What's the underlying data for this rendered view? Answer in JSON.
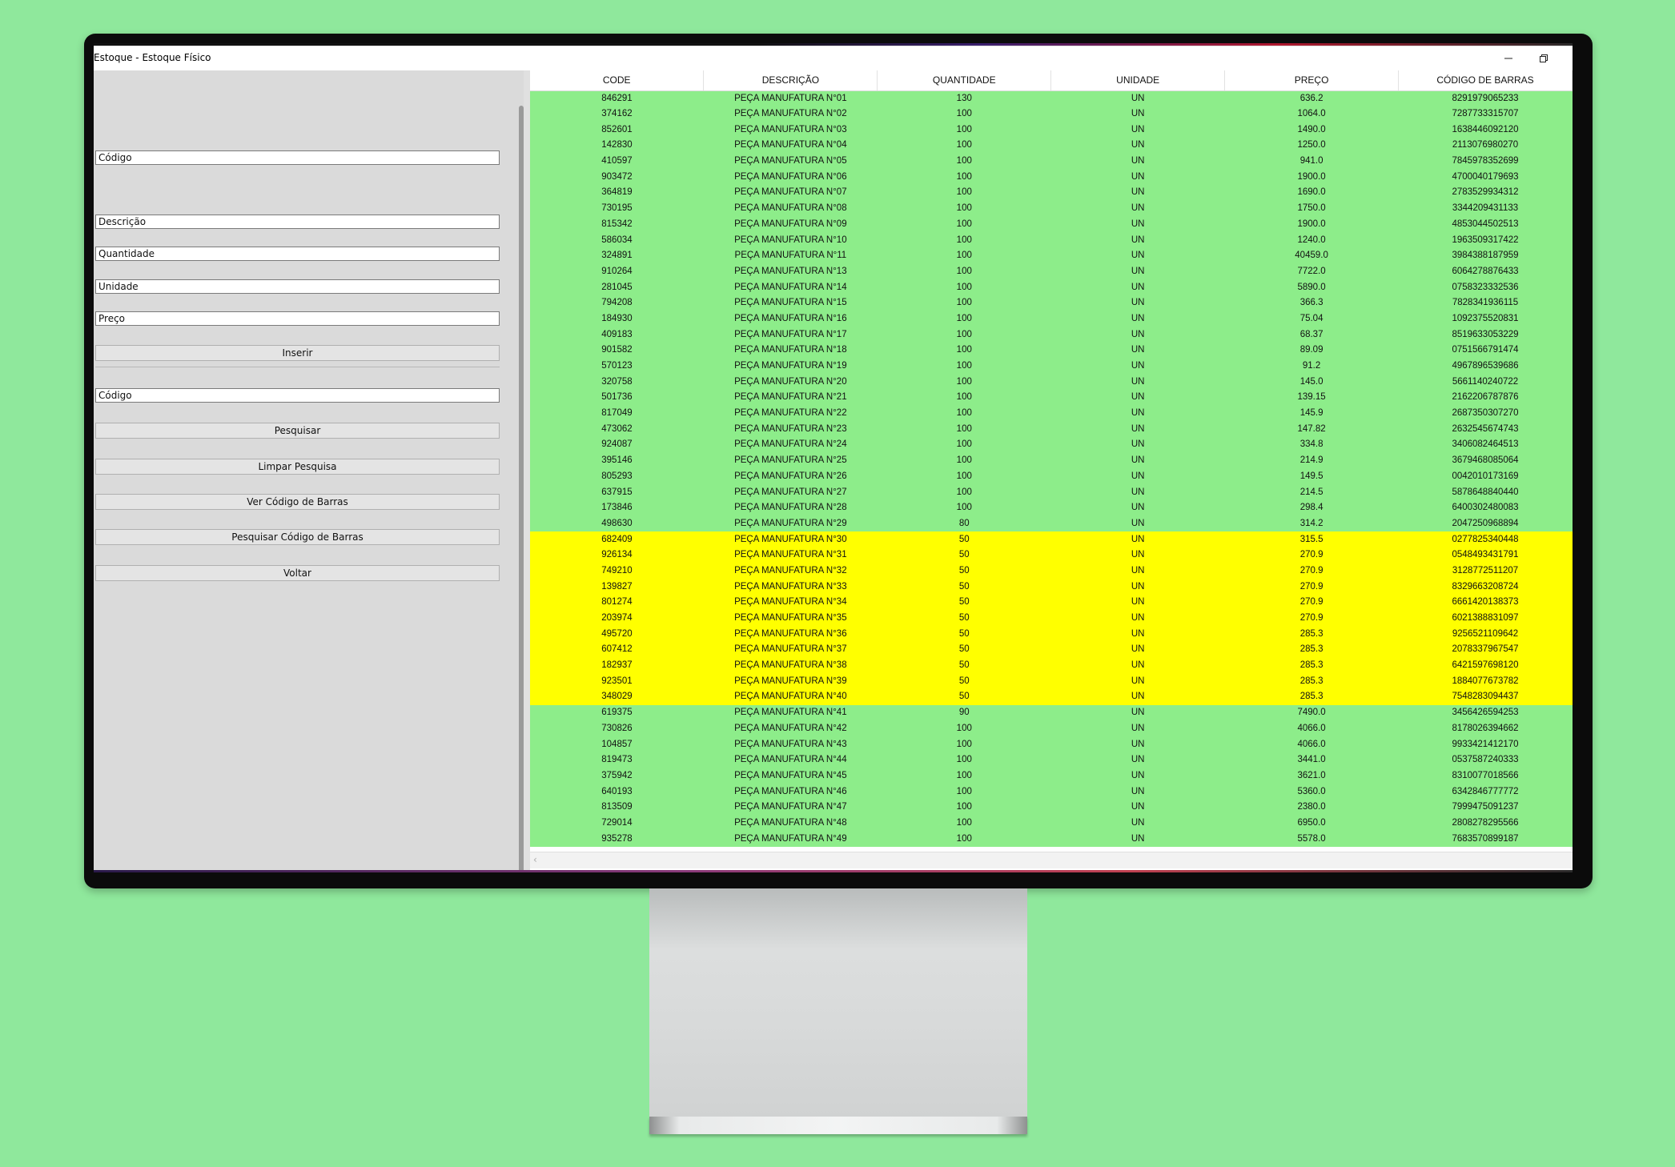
{
  "window": {
    "title": "Estoque - Estoque Físico",
    "minimize_icon": "minimize-icon",
    "restore_icon": "restore-icon",
    "close_icon": "close-icon"
  },
  "form": {
    "codigo_placeholder": "Código",
    "descricao_placeholder": "Descrição",
    "quantidade_placeholder": "Quantidade",
    "unidade_placeholder": "Unidade",
    "preco_placeholder": "Preço",
    "inserir_label": "Inserir",
    "search_codigo_placeholder": "Código",
    "pesquisar_label": "Pesquisar",
    "limpar_label": "Limpar Pesquisa",
    "ver_codigo_label": "Ver Código de Barras",
    "pesquisar_codigo_label": "Pesquisar Código de Barras",
    "voltar_label": "Voltar"
  },
  "table": {
    "columns": [
      "CODE",
      "DESCRIÇÃO",
      "QUANTIDADE",
      "UNIDADE",
      "PREÇO",
      "CÓDIGO DE BARRAS"
    ],
    "colors": {
      "ok": "#8ded8a",
      "low": "#ffff00"
    },
    "rows": [
      [
        "846291",
        "PEÇA MANUFATURA N°01",
        "130",
        "UN",
        "636.2",
        "8291979065233",
        "ok"
      ],
      [
        "374162",
        "PEÇA MANUFATURA N°02",
        "100",
        "UN",
        "1064.0",
        "7287733315707",
        "ok"
      ],
      [
        "852601",
        "PEÇA MANUFATURA N°03",
        "100",
        "UN",
        "1490.0",
        "1638446092120",
        "ok"
      ],
      [
        "142830",
        "PEÇA MANUFATURA N°04",
        "100",
        "UN",
        "1250.0",
        "2113076980270",
        "ok"
      ],
      [
        "410597",
        "PEÇA MANUFATURA N°05",
        "100",
        "UN",
        "941.0",
        "7845978352699",
        "ok"
      ],
      [
        "903472",
        "PEÇA MANUFATURA N°06",
        "100",
        "UN",
        "1900.0",
        "4700040179693",
        "ok"
      ],
      [
        "364819",
        "PEÇA MANUFATURA N°07",
        "100",
        "UN",
        "1690.0",
        "2783529934312",
        "ok"
      ],
      [
        "730195",
        "PEÇA MANUFATURA N°08",
        "100",
        "UN",
        "1750.0",
        "3344209431133",
        "ok"
      ],
      [
        "815342",
        "PEÇA MANUFATURA N°09",
        "100",
        "UN",
        "1900.0",
        "4853044502513",
        "ok"
      ],
      [
        "586034",
        "PEÇA MANUFATURA N°10",
        "100",
        "UN",
        "1240.0",
        "1963509317422",
        "ok"
      ],
      [
        "324891",
        "PEÇA MANUFATURA N°11",
        "100",
        "UN",
        "40459.0",
        "3984388187959",
        "ok"
      ],
      [
        "910264",
        "PEÇA MANUFATURA N°13",
        "100",
        "UN",
        "7722.0",
        "6064278876433",
        "ok"
      ],
      [
        "281045",
        "PEÇA MANUFATURA N°14",
        "100",
        "UN",
        "5890.0",
        "0758323332536",
        "ok"
      ],
      [
        "794208",
        "PEÇA MANUFATURA N°15",
        "100",
        "UN",
        "366.3",
        "7828341936115",
        "ok"
      ],
      [
        "184930",
        "PEÇA MANUFATURA N°16",
        "100",
        "UN",
        "75.04",
        "1092375520831",
        "ok"
      ],
      [
        "409183",
        "PEÇA MANUFATURA N°17",
        "100",
        "UN",
        "68.37",
        "8519633053229",
        "ok"
      ],
      [
        "901582",
        "PEÇA MANUFATURA N°18",
        "100",
        "UN",
        "89.09",
        "0751566791474",
        "ok"
      ],
      [
        "570123",
        "PEÇA MANUFATURA N°19",
        "100",
        "UN",
        "91.2",
        "4967896539686",
        "ok"
      ],
      [
        "320758",
        "PEÇA MANUFATURA N°20",
        "100",
        "UN",
        "145.0",
        "5661140240722",
        "ok"
      ],
      [
        "501736",
        "PEÇA MANUFATURA N°21",
        "100",
        "UN",
        "139.15",
        "2162206787876",
        "ok"
      ],
      [
        "817049",
        "PEÇA MANUFATURA N°22",
        "100",
        "UN",
        "145.9",
        "2687350307270",
        "ok"
      ],
      [
        "473062",
        "PEÇA MANUFATURA N°23",
        "100",
        "UN",
        "147.82",
        "2632545674743",
        "ok"
      ],
      [
        "924087",
        "PEÇA MANUFATURA N°24",
        "100",
        "UN",
        "334.8",
        "3406082464513",
        "ok"
      ],
      [
        "395146",
        "PEÇA MANUFATURA N°25",
        "100",
        "UN",
        "214.9",
        "3679468085064",
        "ok"
      ],
      [
        "805293",
        "PEÇA MANUFATURA N°26",
        "100",
        "UN",
        "149.5",
        "0042010173169",
        "ok"
      ],
      [
        "637915",
        "PEÇA MANUFATURA N°27",
        "100",
        "UN",
        "214.5",
        "5878648840440",
        "ok"
      ],
      [
        "173846",
        "PEÇA MANUFATURA N°28",
        "100",
        "UN",
        "298.4",
        "6400302480083",
        "ok"
      ],
      [
        "498630",
        "PEÇA MANUFATURA N°29",
        "80",
        "UN",
        "314.2",
        "2047250968894",
        "ok"
      ],
      [
        "682409",
        "PEÇA MANUFATURA N°30",
        "50",
        "UN",
        "315.5",
        "0277825340448",
        "low"
      ],
      [
        "926134",
        "PEÇA MANUFATURA N°31",
        "50",
        "UN",
        "270.9",
        "0548493431791",
        "low"
      ],
      [
        "749210",
        "PEÇA MANUFATURA N°32",
        "50",
        "UN",
        "270.9",
        "3128772511207",
        "low"
      ],
      [
        "139827",
        "PEÇA MANUFATURA N°33",
        "50",
        "UN",
        "270.9",
        "8329663208724",
        "low"
      ],
      [
        "801274",
        "PEÇA MANUFATURA N°34",
        "50",
        "UN",
        "270.9",
        "6661420138373",
        "low"
      ],
      [
        "203974",
        "PEÇA MANUFATURA N°35",
        "50",
        "UN",
        "270.9",
        "6021388831097",
        "low"
      ],
      [
        "495720",
        "PEÇA MANUFATURA N°36",
        "50",
        "UN",
        "285.3",
        "9256521109642",
        "low"
      ],
      [
        "607412",
        "PEÇA MANUFATURA N°37",
        "50",
        "UN",
        "285.3",
        "2078337967547",
        "low"
      ],
      [
        "182937",
        "PEÇA MANUFATURA N°38",
        "50",
        "UN",
        "285.3",
        "6421597698120",
        "low"
      ],
      [
        "923501",
        "PEÇA MANUFATURA N°39",
        "50",
        "UN",
        "285.3",
        "1884077673782",
        "low"
      ],
      [
        "348029",
        "PEÇA MANUFATURA N°40",
        "50",
        "UN",
        "285.3",
        "7548283094437",
        "low"
      ],
      [
        "619375",
        "PEÇA MANUFATURA N°41",
        "90",
        "UN",
        "7490.0",
        "3456426594253",
        "ok"
      ],
      [
        "730826",
        "PEÇA MANUFATURA N°42",
        "100",
        "UN",
        "4066.0",
        "8178026394662",
        "ok"
      ],
      [
        "104857",
        "PEÇA MANUFATURA N°43",
        "100",
        "UN",
        "4066.0",
        "9933421412170",
        "ok"
      ],
      [
        "819473",
        "PEÇA MANUFATURA N°44",
        "100",
        "UN",
        "3441.0",
        "0537587240333",
        "ok"
      ],
      [
        "375942",
        "PEÇA MANUFATURA N°45",
        "100",
        "UN",
        "3621.0",
        "8310077018566",
        "ok"
      ],
      [
        "640193",
        "PEÇA MANUFATURA N°46",
        "100",
        "UN",
        "5360.0",
        "6342846777772",
        "ok"
      ],
      [
        "813509",
        "PEÇA MANUFATURA N°47",
        "100",
        "UN",
        "2380.0",
        "7999475091237",
        "ok"
      ],
      [
        "729014",
        "PEÇA MANUFATURA N°48",
        "100",
        "UN",
        "6950.0",
        "2808278295566",
        "ok"
      ],
      [
        "935278",
        "PEÇA MANUFATURA N°49",
        "100",
        "UN",
        "5578.0",
        "7683570899187",
        "ok"
      ]
    ]
  }
}
